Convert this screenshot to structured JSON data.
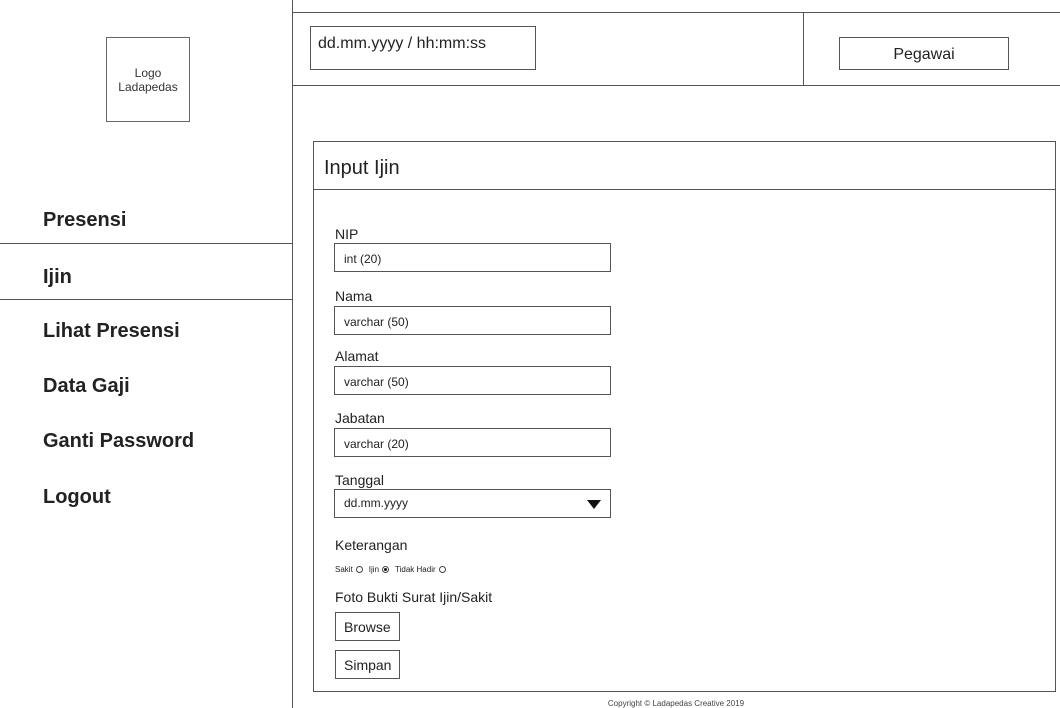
{
  "sidebar": {
    "logo_line1": "Logo",
    "logo_line2": "Ladapedas",
    "items": [
      {
        "label": "Presensi"
      },
      {
        "label": "Ijin"
      },
      {
        "label": "Lihat Presensi"
      },
      {
        "label": "Data Gaji"
      },
      {
        "label": "Ganti Password"
      },
      {
        "label": "Logout"
      }
    ]
  },
  "header": {
    "datetime": "dd.mm.yyyy / hh:mm:ss",
    "role": "Pegawai"
  },
  "form": {
    "title": "Input Ijin",
    "nip_label": "NIP",
    "nip_placeholder": "int (20)",
    "nama_label": "Nama",
    "nama_placeholder": "varchar (50)",
    "alamat_label": "Alamat",
    "alamat_placeholder": "varchar (50)",
    "jabatan_label": "Jabatan",
    "jabatan_placeholder": "varchar (20)",
    "tanggal_label": "Tanggal",
    "tanggal_value": "dd.mm.yyyy",
    "keterangan_label": "Keterangan",
    "options": [
      {
        "label": "Sakit",
        "checked": false
      },
      {
        "label": "Ijin",
        "checked": true
      },
      {
        "label": "Tidak Hadir",
        "checked": false
      }
    ],
    "foto_label": "Foto Bukti Surat Ijin/Sakit",
    "browse_label": "Browse",
    "simpan_label": "Simpan"
  },
  "footer": {
    "copyright": "Copyright © Ladapedas Creative 2019"
  }
}
